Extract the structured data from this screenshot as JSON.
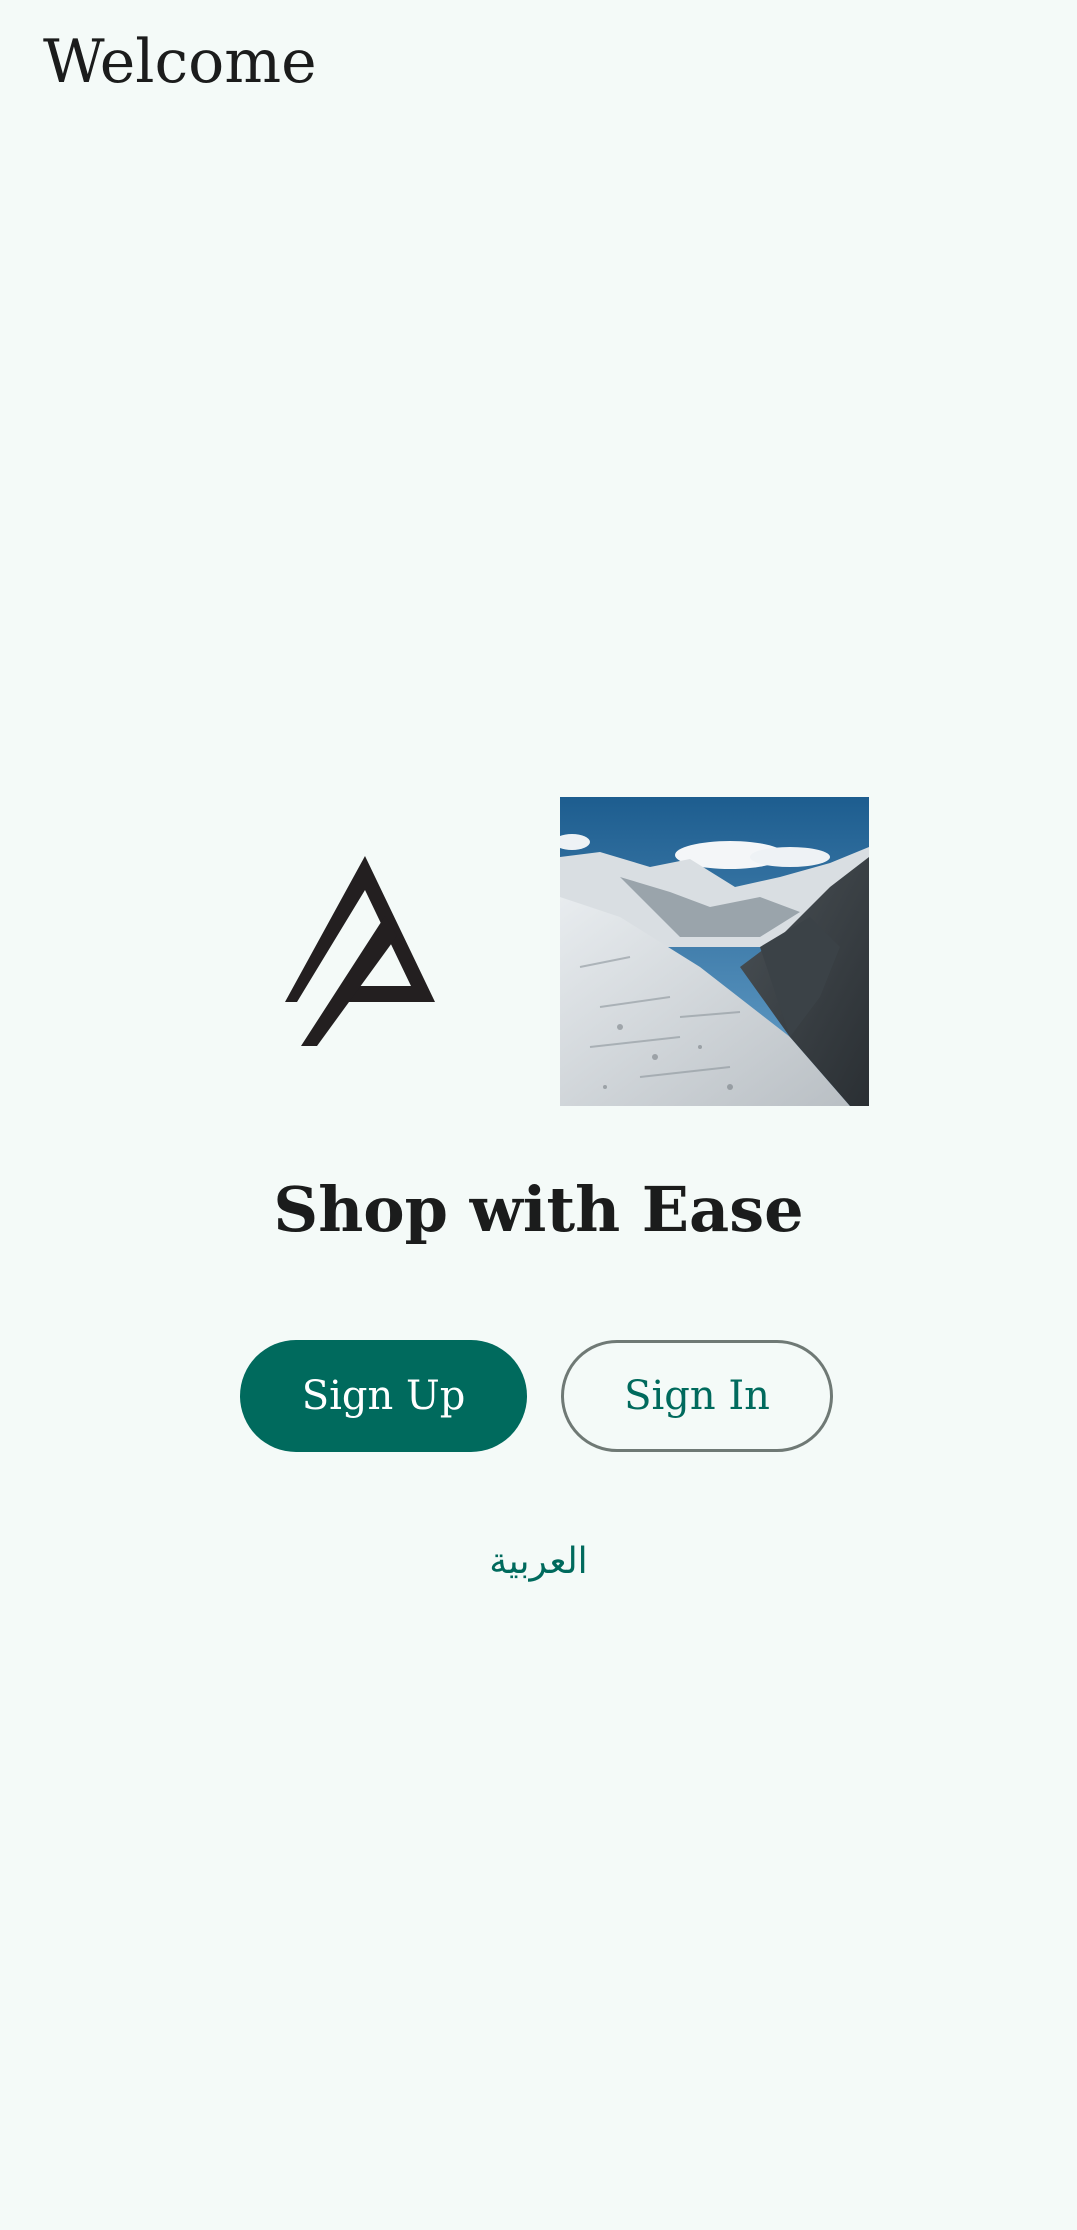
{
  "app_bar": {
    "title": "Welcome"
  },
  "hero": {
    "logo_icon": "brand-logo-icon",
    "image_description_icon": "mountain-landscape-image"
  },
  "headline": "Shop with Ease",
  "actions": {
    "sign_up_label": "Sign Up",
    "sign_in_label": "Sign In"
  },
  "language_link": "العربية",
  "colors": {
    "background": "#f4faf8",
    "primary": "#006a5d",
    "on_primary": "#ffffff",
    "outline": "#6f7975",
    "text": "#1b1c1c"
  }
}
